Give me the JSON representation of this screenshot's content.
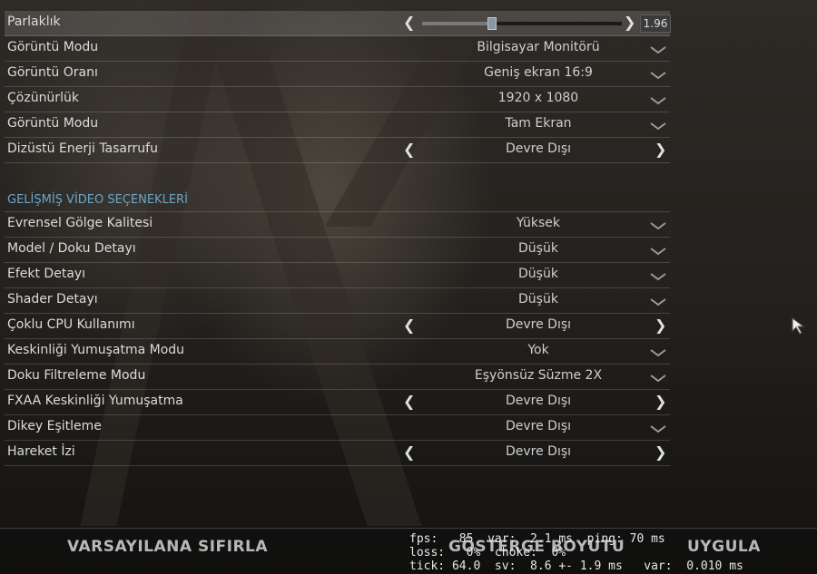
{
  "brightness": {
    "label": "Parlaklık",
    "value": "1.96",
    "level": 0.35
  },
  "basic_rows": [
    {
      "label": "Görüntü Modu",
      "value": "Bilgisayar Monitörü",
      "control": "dropdown"
    },
    {
      "label": "Görüntü Oranı",
      "value": "Geniş ekran 16:9",
      "control": "dropdown"
    },
    {
      "label": "Çözünürlük",
      "value": "1920 x 1080",
      "control": "dropdown"
    },
    {
      "label": "Görüntü Modu",
      "value": "Tam Ekran",
      "control": "dropdown"
    },
    {
      "label": "Dizüstü Enerji Tasarrufu",
      "value": "Devre Dışı",
      "control": "arrows"
    }
  ],
  "advanced": {
    "title": "GELİŞMİŞ VİDEO SEÇENEKLERİ",
    "rows": [
      {
        "label": "Evrensel Gölge Kalitesi",
        "value": "Yüksek",
        "control": "dropdown"
      },
      {
        "label": "Model / Doku Detayı",
        "value": "Düşük",
        "control": "dropdown"
      },
      {
        "label": "Efekt Detayı",
        "value": "Düşük",
        "control": "dropdown"
      },
      {
        "label": "Shader Detayı",
        "value": "Düşük",
        "control": "dropdown"
      },
      {
        "label": "Çoklu CPU Kullanımı",
        "value": "Devre Dışı",
        "control": "arrows"
      },
      {
        "label": "Keskinliği Yumuşatma Modu",
        "value": "Yok",
        "control": "dropdown"
      },
      {
        "label": "Doku Filtreleme Modu",
        "value": "Eşyönsüz Süzme 2X",
        "control": "dropdown"
      },
      {
        "label": "FXAA Keskinliği Yumuşatma",
        "value": "Devre Dışı",
        "control": "arrows"
      },
      {
        "label": "Dikey Eşitleme",
        "value": "Devre Dışı",
        "control": "dropdown"
      },
      {
        "label": "Hareket İzi",
        "value": "Devre Dışı",
        "control": "arrows"
      }
    ]
  },
  "footer": {
    "reset": "VARSAYILANA SIFIRLA",
    "hud_size": "GÖSTERGE BOYUTU",
    "apply": "UYGULA"
  },
  "netgraph": {
    "line1": "fps:   85  var:  2.1 ms  ping: 70 ms",
    "line2": "loss:   0%  choke:  0%",
    "line3": "tick: 64.0  sv:  8.6 +- 1.9 ms   var:  0.010 ms"
  },
  "icons": {
    "dropdown": "chevron-down-icon",
    "prev": "arrow-left-icon",
    "next": "arrow-right-icon",
    "cursor": "mouse-pointer-icon"
  },
  "colors": {
    "section_title": "#6aa6c8",
    "text": "#dcdcdc"
  }
}
